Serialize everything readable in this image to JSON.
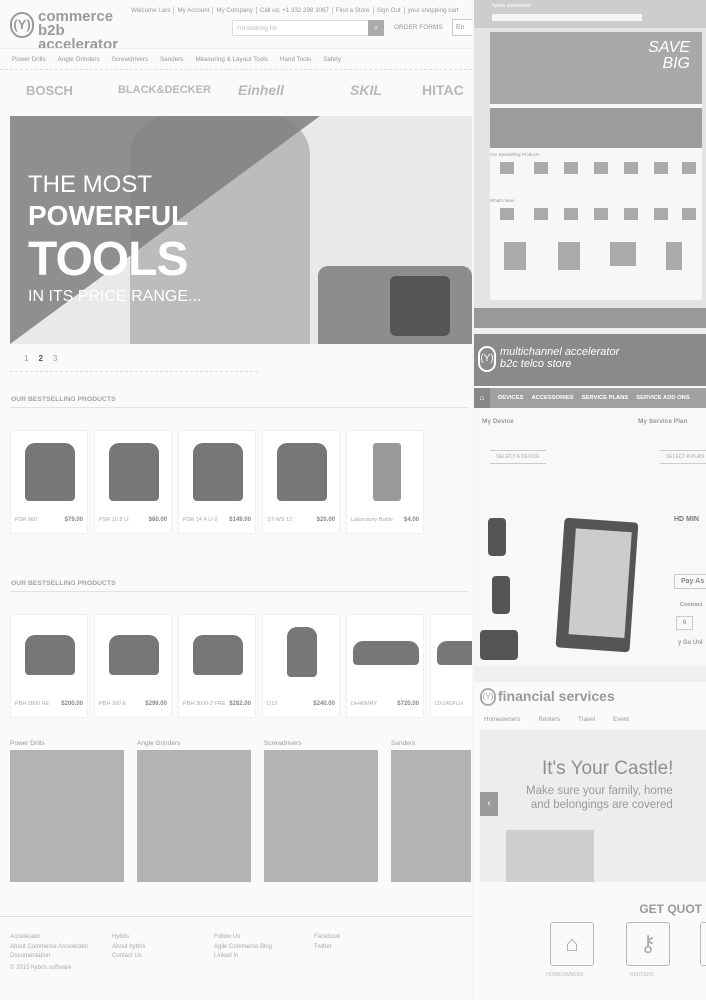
{
  "b2b": {
    "logo_mark": "(Y)",
    "logo_line1": "commerce",
    "logo_line2": "b2b accelerator",
    "top_links": [
      "Welcome Lars",
      "My Account",
      "My Company",
      "Call us: +1 332 298 3067",
      "Find a Store",
      "Sign Out",
      "your shopping cart"
    ],
    "search_placeholder": "I'm looking for",
    "search_icon": "magnifier",
    "order_forms": "ORDER FORMS",
    "language": "En",
    "nav": [
      "Power Drills",
      "Angle Grinders",
      "Screwdrivers",
      "Sanders",
      "Measuring & Layout Tools",
      "Hand Tools",
      "Safety"
    ],
    "brands": [
      "BOSCH",
      "BLACK&DECKER",
      "Einhell",
      "SKIL",
      "HITAC"
    ],
    "hero": {
      "line1": "THE MOST",
      "line2": "POWERFUL",
      "line3": "TOOLS",
      "line4": "IN ITS PRICE RANGE..."
    },
    "pager": [
      "1",
      "2",
      "3"
    ],
    "pager_active": "2",
    "section1_title": "OUR BESTSELLING PRODUCTS",
    "section1_products": [
      {
        "name": "PSR 960",
        "price": "$79.00"
      },
      {
        "name": "PSR 10.8 LI",
        "price": "$80.00"
      },
      {
        "name": "PSR 14.4 LI-2",
        "price": "$149.00"
      },
      {
        "name": "ST-WS 12",
        "price": "$20.00"
      },
      {
        "name": "Laboratory Bottle",
        "price": "$4.00"
      }
    ],
    "section2_title": "OUR BESTSELLING PRODUCTS",
    "section2_products": [
      {
        "name": "PBH 2800 RE",
        "price": "$200.00"
      },
      {
        "name": "PBH 300 E",
        "price": "$299.00"
      },
      {
        "name": "PBH 3000-2 FRE",
        "price": "$282.00"
      },
      {
        "name": "D13",
        "price": "$240.00"
      },
      {
        "name": "DH40MRY",
        "price": "$720.00"
      },
      {
        "name": "DX14DFLH",
        "price": ""
      }
    ],
    "categories": [
      "Power Drills",
      "Angle Grinders",
      "Screwdrivers",
      "Sanders"
    ],
    "footer": {
      "col1": [
        "Accelerator",
        "About Commerce Accelerator",
        "Documentation"
      ],
      "col2": [
        "Hybris",
        "About hybris",
        "Contact Us"
      ],
      "col3": [
        "Follow Us",
        "Agile Commerce Blog",
        "Linked In"
      ],
      "col4": [
        "",
        "Facebook",
        "Twitter"
      ],
      "copyright": "© 2015 hybris software"
    }
  },
  "electronics": {
    "top_text": "hybris electronics",
    "banner_line1": "SAVE",
    "banner_line2": "BIG",
    "label1": "Our Bestselling Products",
    "label2": "What's New"
  },
  "telco": {
    "logo_mark": "(Y)",
    "brand_line1": "multichannel accelerator",
    "brand_line2": "b2c telco store",
    "nav_home_icon": "home",
    "nav": [
      "DEVICES",
      "ACCESSORIES",
      "SERVICE PLANS",
      "SERVICE ADD ONS"
    ],
    "my_device": "My Device",
    "my_service_plan": "My Service Plan",
    "select_device": "SELECT A DEVICE",
    "select_plan": "SELECT A PLAN",
    "product_title": "HD MIN",
    "pay_as": "Pay As",
    "contract": "Contract",
    "qty": "0",
    "go_unlimited": "y Go Unl"
  },
  "financial": {
    "logo_mark": "(Y)",
    "brand": "financial services",
    "tabs": [
      "Homeowners",
      "Renters",
      "Travel",
      "Event"
    ],
    "hero_title": "It's Your Castle!",
    "hero_sub1": "Make sure your family, home",
    "hero_sub2": "and belongings are covered",
    "get_quote": "GET QUOT",
    "icons": [
      {
        "icon": "house-icon",
        "label": "HOMEOWNERS"
      },
      {
        "icon": "key-icon",
        "label": "RENTERS"
      }
    ]
  }
}
